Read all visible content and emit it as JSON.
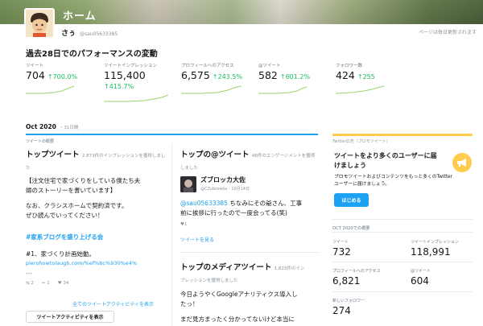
{
  "header": {
    "banner_title": "ホーム",
    "user_name": "さぅ",
    "user_handle": "@sau05633385",
    "update_note": "ページは毎日更新されます"
  },
  "performance": {
    "title": "過去28日でのパフォーマンスの変動",
    "metrics": [
      {
        "label": "ツイート",
        "value": "704",
        "change": "700.0%"
      },
      {
        "label": "ツイートインプレッション",
        "value": "115,400",
        "change": "415.7%"
      },
      {
        "label": "プロフィールへのアクセス",
        "value": "6,575",
        "change": "243.5%"
      },
      {
        "label": "@ツイート",
        "value": "582",
        "change": "601.2%"
      },
      {
        "label": "フォロワー数",
        "value": "424",
        "change": "255"
      }
    ]
  },
  "month": {
    "title": "Oct 2020",
    "days": "・31日間",
    "sub": "ツイートの概要"
  },
  "top_tweet": {
    "heading": "トップツイート",
    "meta": "2,873件のインプレッションを獲得しました",
    "lines": [
      "【注文住宅で家づくりをしている僕たち夫",
      "婦のストーリーを書いています】",
      "",
      "なお、クラシスホームで契約済です。",
      "ぜひ読んでいってください！"
    ],
    "hashtag": "#家系ブログを盛り上げる会",
    "line2": "#1、家づくり計画始動。",
    "url": "pierohowtolaugh.com/%ef%bc%930%e4%",
    "ellipsis": "…",
    "retweets": "2",
    "replies": "1",
    "likes": "34",
    "all_activity": "全てのツイートアクティビティを表示",
    "view_button": "ツイートアクティビティを表示"
  },
  "top_mention": {
    "heading": "トップの@ツイート",
    "meta": "48件のエンゲージメントを獲得しました",
    "author": "ズブロッカ大佐",
    "author_handle": "@CZubrowka",
    "date": "・10月14日",
    "mention": "@sau05633385",
    "text1": " ちなみにその爺さん、工事",
    "text2": "前に挨拶に行ったので一度会ってる(笑)",
    "likes": "1",
    "view_tweet": "ツイートを見る"
  },
  "top_media": {
    "heading": "トップのメディアツイート",
    "meta1": "1,823件のイン",
    "meta2": "プレッションを獲得しました",
    "line1": "今日ようやくGoogleアナリティクス導入し",
    "line2": "たっ！",
    "line3": "まだ見方まったく分かってないけど本当に"
  },
  "promo": {
    "head": "Twitter広告（プロモツイート）",
    "title": "ツイートをより多くのユーザーに届けましょう",
    "desc": "プロモツイートおよびコンテンツをもっと多くのTwitterユーザーに届けましょう。",
    "button": "はじめる"
  },
  "summary": {
    "head": "OCT 2020での概要",
    "cells": [
      {
        "label": "ツイート",
        "value": "732"
      },
      {
        "label": "ツイートインプレッション",
        "value": "118,991"
      },
      {
        "label": "プロフィールへのアクセス",
        "value": "6,821"
      },
      {
        "label": "@ツイート",
        "value": "604"
      },
      {
        "label": "新しいフォロワー",
        "value": "274"
      }
    ]
  }
}
